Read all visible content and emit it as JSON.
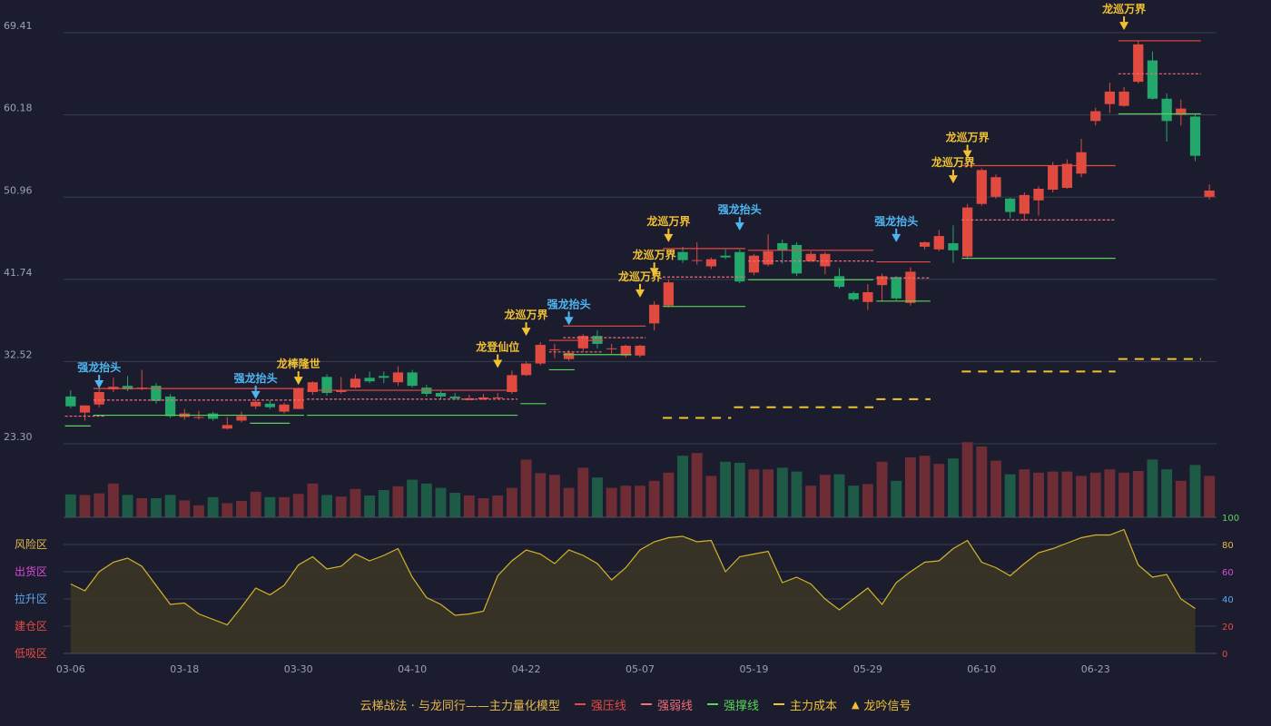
{
  "chart_data": {
    "type": "candlestick",
    "price_axis": {
      "ticks": [
        "69.41",
        "60.18",
        "50.96",
        "41.74",
        "32.52",
        "23.30"
      ],
      "values": [
        69.41,
        60.18,
        50.96,
        41.74,
        32.52,
        23.3
      ]
    },
    "x_ticks": [
      {
        "label": "03-06",
        "i": 0
      },
      {
        "label": "03-18",
        "i": 8
      },
      {
        "label": "03-30",
        "i": 16
      },
      {
        "label": "04-10",
        "i": 24
      },
      {
        "label": "04-22",
        "i": 32
      },
      {
        "label": "05-07",
        "i": 40
      },
      {
        "label": "05-19",
        "i": 48
      },
      {
        "label": "05-29",
        "i": 56
      },
      {
        "label": "06-10",
        "i": 64
      },
      {
        "label": "06-23",
        "i": 72
      }
    ],
    "candles": [
      [
        28.6,
        27.5,
        29.3,
        27.3
      ],
      [
        26.8,
        27.6,
        27.6,
        25.9
      ],
      [
        27.7,
        29.1,
        29.5,
        27.4
      ],
      [
        29.4,
        29.7,
        30.7,
        29.1
      ],
      [
        29.8,
        29.4,
        30.9,
        29.2
      ],
      [
        29.5,
        29.6,
        31.6,
        29.3
      ],
      [
        29.8,
        28.1,
        30.1,
        27.8
      ],
      [
        28.6,
        26.4,
        28.9,
        26.2
      ],
      [
        26.3,
        26.7,
        27.2,
        26.0
      ],
      [
        26.2,
        26.3,
        27.0,
        26.0
      ],
      [
        26.7,
        26.1,
        26.9,
        25.9
      ],
      [
        25.0,
        25.4,
        26.3,
        24.9
      ],
      [
        25.9,
        26.4,
        26.9,
        25.7
      ],
      [
        27.5,
        28.0,
        28.2,
        27.2
      ],
      [
        27.8,
        27.4,
        28.2,
        27.2
      ],
      [
        26.9,
        27.7,
        27.9,
        26.7
      ],
      [
        27.2,
        29.5,
        29.6,
        27.2
      ],
      [
        29.1,
        30.2,
        30.3,
        28.8
      ],
      [
        30.8,
        29.0,
        31.1,
        28.7
      ],
      [
        29.1,
        29.3,
        30.8,
        28.9
      ],
      [
        29.6,
        30.6,
        31.1,
        29.5
      ],
      [
        30.7,
        30.3,
        31.4,
        30.1
      ],
      [
        30.9,
        30.7,
        31.4,
        30.1
      ],
      [
        30.2,
        31.3,
        32.0,
        29.8
      ],
      [
        31.3,
        29.8,
        31.6,
        29.6
      ],
      [
        29.6,
        28.9,
        29.9,
        28.6
      ],
      [
        29.0,
        28.6,
        29.2,
        28.3
      ],
      [
        28.6,
        28.4,
        29.0,
        28.2
      ],
      [
        28.2,
        28.4,
        28.8,
        28.2
      ],
      [
        28.3,
        28.5,
        28.9,
        28.2
      ],
      [
        28.5,
        28.5,
        29.0,
        28.3
      ],
      [
        29.1,
        31.0,
        31.5,
        28.9
      ],
      [
        31.0,
        32.3,
        32.5,
        30.9
      ],
      [
        32.3,
        34.4,
        34.7,
        32.1
      ],
      [
        33.9,
        33.9,
        34.5,
        32.9
      ],
      [
        32.8,
        33.5,
        33.8,
        32.6
      ],
      [
        34.0,
        35.4,
        35.6,
        33.7
      ],
      [
        35.4,
        34.5,
        36.0,
        34.0
      ],
      [
        34.0,
        34.0,
        34.5,
        33.4
      ],
      [
        33.2,
        34.3,
        34.4,
        33.0
      ],
      [
        33.2,
        34.3,
        34.4,
        33.0
      ],
      [
        36.8,
        38.9,
        39.3,
        36.0
      ],
      [
        38.8,
        41.4,
        41.7,
        38.6
      ],
      [
        44.8,
        43.9,
        45.4,
        43.6
      ],
      [
        43.9,
        43.9,
        45.9,
        43.4
      ],
      [
        43.2,
        44.0,
        44.2,
        42.9
      ],
      [
        44.4,
        44.2,
        45.1,
        44.0
      ],
      [
        44.8,
        41.5,
        45.1,
        41.3
      ],
      [
        42.5,
        44.4,
        44.6,
        42.2
      ],
      [
        43.4,
        44.9,
        46.8,
        43.2
      ],
      [
        45.8,
        45.0,
        46.2,
        43.5
      ],
      [
        45.6,
        42.4,
        45.9,
        42.1
      ],
      [
        43.8,
        44.6,
        44.9,
        43.7
      ],
      [
        43.2,
        44.6,
        44.8,
        42.3
      ],
      [
        42.1,
        40.9,
        43.0,
        40.7
      ],
      [
        40.2,
        39.5,
        40.4,
        39.3
      ],
      [
        39.2,
        40.3,
        41.2,
        38.3
      ],
      [
        41.1,
        42.1,
        42.4,
        39.3
      ],
      [
        42.0,
        39.6,
        42.1,
        39.4
      ],
      [
        39.1,
        42.6,
        43.1,
        38.8
      ],
      [
        45.4,
        45.9,
        46.0,
        45.1
      ],
      [
        45.1,
        46.6,
        47.3,
        44.9
      ],
      [
        45.8,
        45.0,
        47.8,
        43.6
      ],
      [
        44.3,
        49.8,
        50.2,
        44.0
      ],
      [
        50.2,
        54.0,
        54.2,
        50.0
      ],
      [
        51.0,
        53.2,
        53.5,
        50.8
      ],
      [
        50.8,
        49.3,
        50.9,
        48.6
      ],
      [
        49.1,
        51.2,
        51.5,
        48.3
      ],
      [
        50.6,
        51.9,
        52.2,
        48.9
      ],
      [
        51.8,
        54.5,
        54.9,
        51.5
      ],
      [
        52.0,
        54.7,
        55.2,
        51.9
      ],
      [
        53.6,
        56.0,
        57.5,
        53.2
      ],
      [
        59.5,
        60.6,
        61.0,
        59.0
      ],
      [
        61.4,
        62.8,
        63.8,
        60.4
      ],
      [
        61.2,
        62.8,
        63.3,
        61.1
      ],
      [
        63.9,
        68.1,
        68.5,
        63.7
      ],
      [
        66.3,
        62.0,
        67.3,
        61.9
      ],
      [
        62.0,
        59.5,
        62.6,
        57.2
      ],
      [
        60.2,
        60.9,
        61.9,
        59.0
      ],
      [
        60.0,
        55.6,
        60.2,
        55.0
      ],
      [
        51.0,
        51.7,
        52.4,
        50.7
      ]
    ],
    "volume_colors": "rise red / fall green",
    "volume_relative": [
      0.42,
      0.41,
      0.44,
      0.62,
      0.41,
      0.35,
      0.35,
      0.41,
      0.31,
      0.22,
      0.37,
      0.26,
      0.3,
      0.47,
      0.37,
      0.37,
      0.43,
      0.62,
      0.41,
      0.38,
      0.52,
      0.4,
      0.5,
      0.57,
      0.69,
      0.62,
      0.54,
      0.45,
      0.4,
      0.35,
      0.4,
      0.54,
      1.06,
      0.81,
      0.78,
      0.54,
      0.91,
      0.73,
      0.54,
      0.58,
      0.58,
      0.67,
      0.82,
      1.13,
      1.18,
      0.76,
      1.02,
      1.0,
      0.88,
      0.88,
      0.91,
      0.84,
      0.58,
      0.78,
      0.79,
      0.58,
      0.61,
      1.02,
      0.67,
      1.1,
      1.13,
      0.98,
      1.08,
      1.38,
      1.3,
      1.04,
      0.79,
      0.88,
      0.82,
      0.84,
      0.84,
      0.76,
      0.82,
      0.88,
      0.82,
      0.85,
      1.06,
      0.88,
      0.67,
      0.96,
      0.76
    ],
    "lines": {
      "pressure": [
        [
          2,
          16,
          29.5
        ],
        [
          17,
          31,
          29.3
        ],
        [
          34,
          37,
          34.9
        ],
        [
          35,
          40,
          36.5
        ],
        [
          42,
          47,
          45.2
        ],
        [
          48,
          56,
          45.0
        ],
        [
          57,
          60,
          43.7
        ],
        [
          63,
          73,
          54.5
        ],
        [
          74,
          79,
          68.5
        ]
      ],
      "weak": [
        [
          0,
          2,
          26.4
        ],
        [
          2,
          16,
          28.2
        ],
        [
          17,
          31,
          28.3
        ],
        [
          34,
          37,
          33.6
        ],
        [
          35,
          40,
          35.2
        ],
        [
          42,
          47,
          42.0
        ],
        [
          48,
          56,
          43.8
        ],
        [
          57,
          60,
          41.9
        ],
        [
          63,
          73,
          48.4
        ],
        [
          74,
          79,
          64.8
        ]
      ],
      "support": [
        [
          0,
          1,
          25.3
        ],
        [
          2,
          16,
          26.5
        ],
        [
          13,
          15,
          25.6
        ],
        [
          17,
          31,
          26.5
        ],
        [
          32,
          33,
          27.8
        ],
        [
          34,
          35,
          31.6
        ],
        [
          35,
          39,
          33.3
        ],
        [
          42,
          47,
          38.7
        ],
        [
          48,
          56,
          41.7
        ],
        [
          57,
          60,
          39.3
        ],
        [
          63,
          73,
          44.1
        ],
        [
          74,
          79,
          60.3
        ]
      ],
      "cost": [
        [
          42,
          46,
          26.2
        ],
        [
          47,
          56,
          27.4
        ],
        [
          57,
          60,
          28.3
        ],
        [
          63,
          73,
          31.4
        ],
        [
          74,
          79,
          32.8
        ]
      ]
    },
    "signals": [
      {
        "i": 2,
        "text": "强龙抬头",
        "kind": "blue",
        "price": 29.2
      },
      {
        "i": 13,
        "text": "强龙抬头",
        "kind": "blue",
        "price": 28.0
      },
      {
        "i": 16,
        "text": "龙棒隆世",
        "kind": "gold",
        "price": 29.6
      },
      {
        "i": 30,
        "text": "龙登仙位",
        "kind": "gold",
        "price": 31.5
      },
      {
        "i": 32,
        "text": "龙巡万界",
        "kind": "gold",
        "price": 35.1
      },
      {
        "i": 35,
        "text": "强龙抬头",
        "kind": "blue",
        "price": 36.3
      },
      {
        "i": 40,
        "text": "龙巡万界",
        "kind": "gold",
        "price": 39.4
      },
      {
        "i": 41,
        "text": "龙巡万界",
        "kind": "gold",
        "price": 41.8
      },
      {
        "i": 42,
        "text": "龙巡万界",
        "kind": "gold",
        "price": 45.6
      },
      {
        "i": 47,
        "text": "强龙抬头",
        "kind": "blue",
        "price": 46.9
      },
      {
        "i": 58,
        "text": "强龙抬头",
        "kind": "blue",
        "price": 45.6
      },
      {
        "i": 62,
        "text": "龙巡万界",
        "kind": "gold",
        "price": 52.2
      },
      {
        "i": 63,
        "text": "龙巡万界",
        "kind": "gold",
        "price": 55.0
      },
      {
        "i": 74,
        "text": "龙巡万界",
        "kind": "gold",
        "price": 69.4
      }
    ],
    "oscillator": {
      "ticks": [
        "100",
        "80",
        "60",
        "40",
        "20",
        "0"
      ],
      "zones": [
        "风险区",
        "出货区",
        "拉升区",
        "建仓区",
        "低吸区"
      ],
      "values": [
        51,
        46,
        60,
        67,
        70,
        64,
        50,
        36,
        37,
        29,
        25,
        21,
        34,
        48,
        43,
        50,
        65,
        71,
        62,
        64,
        73,
        68,
        72,
        77,
        56,
        41,
        36,
        28,
        29,
        31,
        57,
        68,
        76,
        73,
        66,
        76,
        72,
        66,
        54,
        63,
        76,
        82,
        85,
        86,
        82,
        83,
        60,
        71,
        73,
        75,
        52,
        56,
        51,
        40,
        32,
        40,
        48,
        36,
        52,
        60,
        67,
        68,
        77,
        83,
        67,
        63,
        57,
        66,
        74,
        77,
        81,
        85,
        87,
        87,
        91,
        65,
        56,
        58,
        40,
        33
      ]
    }
  },
  "legend": {
    "title": "云梯战法 · 与龙同行——主力量化模型",
    "items": [
      {
        "label": "强压线",
        "color": "#e84a42"
      },
      {
        "label": "强弱线",
        "color": "#f06e78"
      },
      {
        "label": "强撑线",
        "color": "#5ad35a"
      },
      {
        "label": "主力成本",
        "color": "#f2c232"
      },
      {
        "label": "龙吟信号",
        "color": "#f2c232"
      }
    ]
  },
  "colors": {
    "up": "#e04a3f",
    "down": "#22a86a",
    "grid": "#3a3c52",
    "axis_text": "#9da0b4",
    "bg": "#1b1c2e",
    "osc_line": "#d4b32a",
    "gold": "#f2c232",
    "blue": "#4fb6f2"
  }
}
